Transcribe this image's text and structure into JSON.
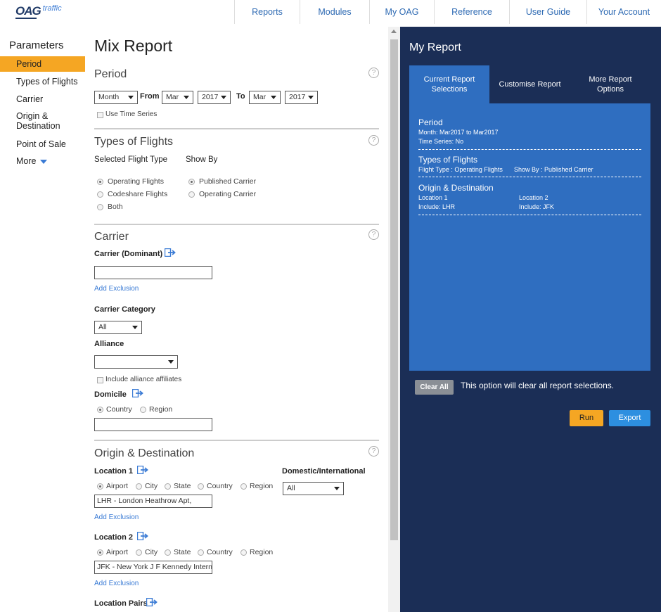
{
  "brand": {
    "logo": "OAG",
    "product": "traffic"
  },
  "topnav": [
    "Reports",
    "Modules",
    "My OAG",
    "Reference",
    "User Guide",
    "Your Account"
  ],
  "leftnav": {
    "title": "Parameters",
    "items": [
      "Period",
      "Types of Flights",
      "Carrier",
      "Origin & Destination",
      "Point of Sale",
      "More"
    ],
    "active": "Period"
  },
  "page_title": "Mix Report",
  "period": {
    "title": "Period",
    "granularity": "Month",
    "from_label": "From",
    "from_month": "Mar",
    "from_year": "2017",
    "to_label": "To",
    "to_month": "Mar",
    "to_year": "2017",
    "time_series_label": "Use Time Series"
  },
  "types_of_flights": {
    "title": "Types of Flights",
    "selected_label": "Selected Flight Type",
    "show_by_label": "Show By",
    "flight_types": [
      "Operating Flights",
      "Codeshare Flights",
      "Both"
    ],
    "flight_type_selected": "Operating Flights",
    "show_by": [
      "Published Carrier",
      "Operating Carrier"
    ],
    "show_by_selected": "Published Carrier"
  },
  "carrier": {
    "title": "Carrier",
    "dominant_label": "Carrier (Dominant)",
    "dominant_value": "",
    "add_exclusion": "Add Exclusion",
    "category_label": "Carrier Category",
    "category_value": "All",
    "alliance_label": "Alliance",
    "alliance_value": "",
    "affiliates_label": "Include alliance affiliates",
    "domicile_label": "Domicile",
    "domicile_options": [
      "Country",
      "Region"
    ],
    "domicile_selected": "Country",
    "domicile_value": ""
  },
  "origin_destination": {
    "title": "Origin & Destination",
    "loc1_label": "Location 1",
    "loc2_label": "Location 2",
    "loc_types": [
      "Airport",
      "City",
      "State",
      "Country",
      "Region"
    ],
    "loc_type_selected": "Airport",
    "loc1_value": "LHR - London Heathrow Apt,",
    "loc2_value": "JFK - New York J F Kennedy Interna",
    "add_exclusion": "Add Exclusion",
    "dom_int_label": "Domestic/International",
    "dom_int_value": "All",
    "pairs_label": "Location Pairs"
  },
  "my_report": {
    "title": "My Report",
    "tabs": [
      "Current Report Selections",
      "Customise Report",
      "More Report Options"
    ],
    "active_tab": "Current Report Selections",
    "period_title": "Period",
    "period_line1": "Month: Mar2017  to Mar2017",
    "period_line2": "Time Series: No",
    "tof_title": "Types of Flights",
    "tof_line": "Flight Type : Operating Flights",
    "tof_showby": "Show By : Published Carrier",
    "od_title": "Origin & Destination",
    "od_loc1": "Location 1",
    "od_loc1_incl": "Include: LHR",
    "od_loc2": "Location 2",
    "od_loc2_incl": "Include: JFK",
    "clear_all": "Clear All",
    "clear_note": "This option will clear all report selections.",
    "run": "Run",
    "export": "Export"
  },
  "colors": {
    "accent": "#f5a623",
    "navy": "#1b2e56",
    "blue": "#2f6ec0",
    "link": "#3a7bd5",
    "export": "#2d8fe0"
  }
}
